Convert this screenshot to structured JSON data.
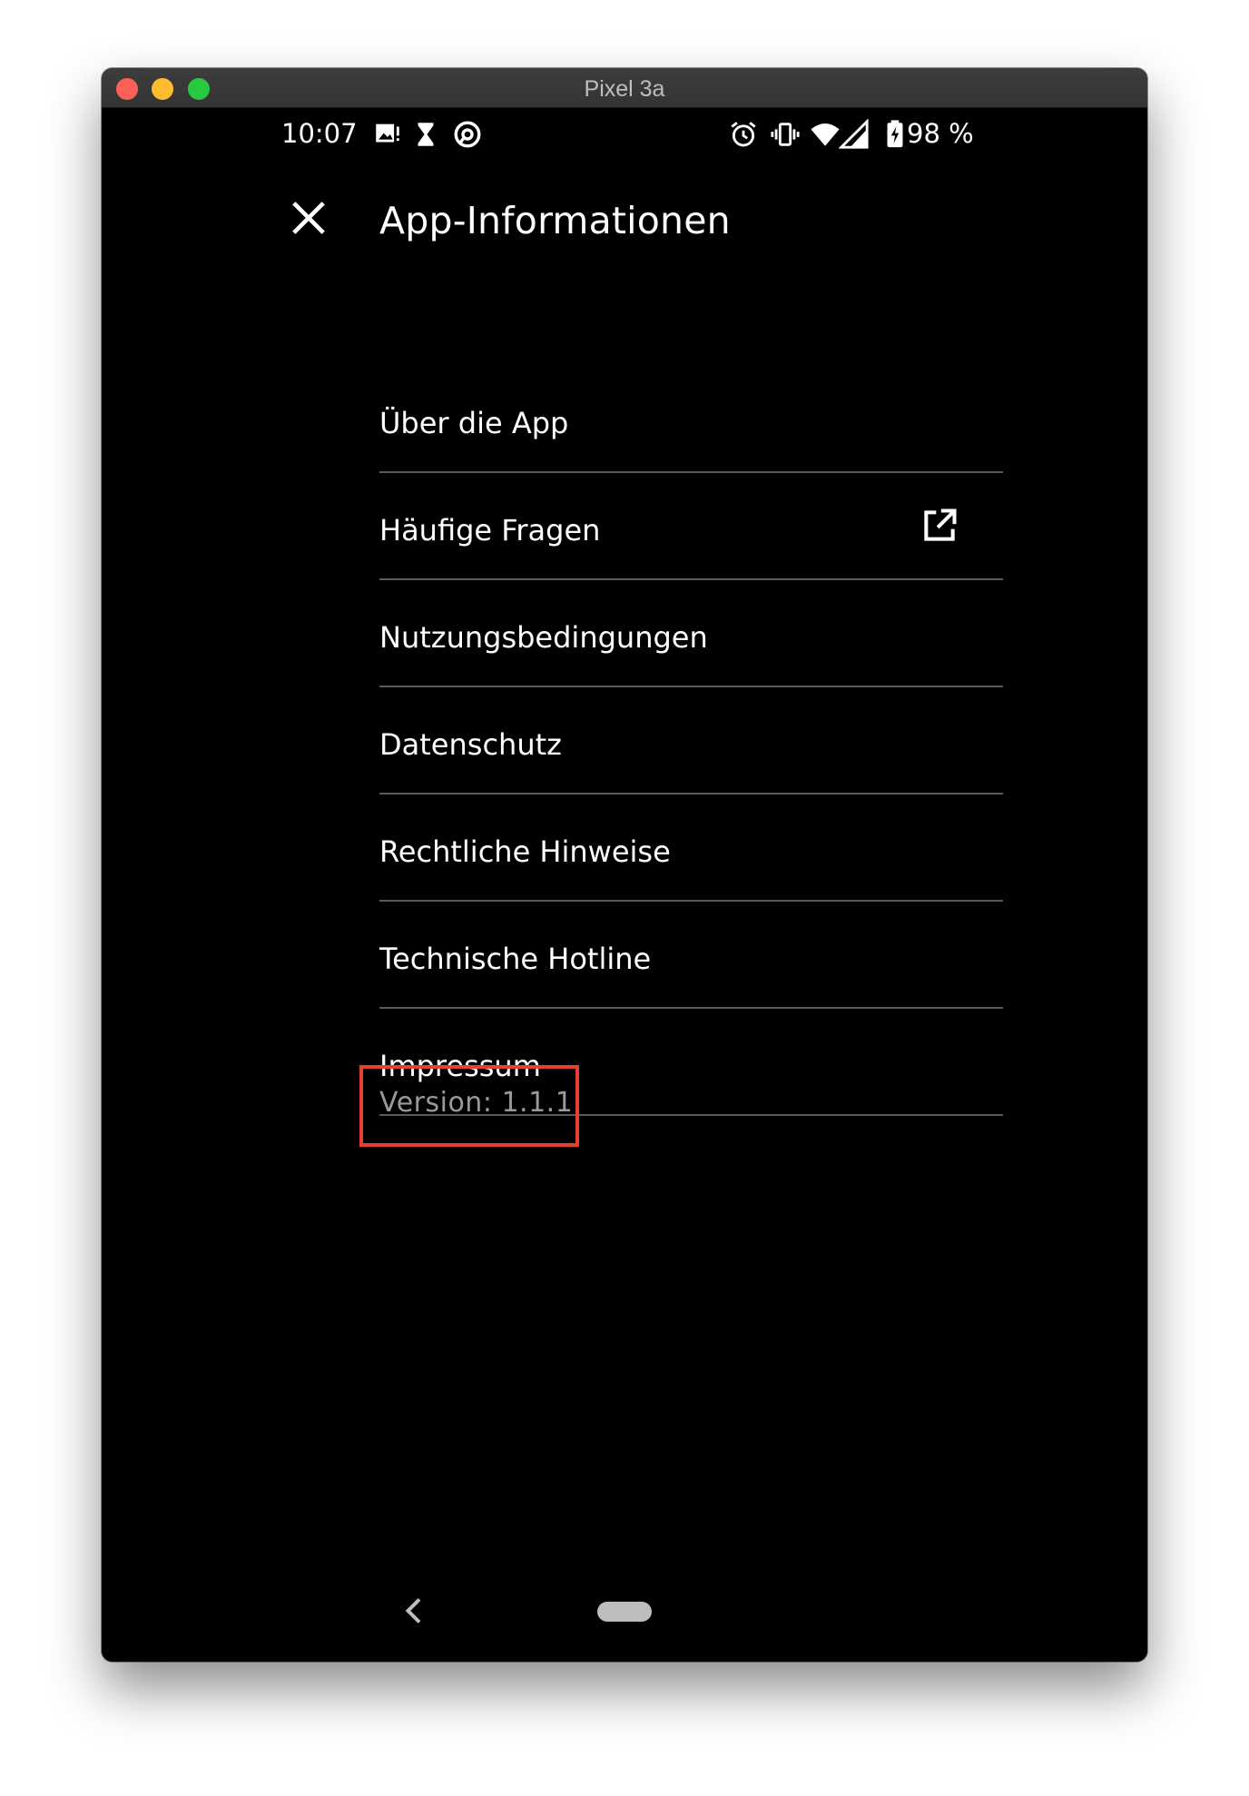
{
  "window": {
    "title": "Pixel 3a"
  },
  "statusbar": {
    "time": "10:07",
    "battery": "98 %",
    "left_icons": [
      "image-notification-icon",
      "hourglass-icon",
      "at-sync-icon"
    ],
    "right_icons": [
      "alarm-icon",
      "vibrate-icon",
      "wifi-icon",
      "signal-icon",
      "battery-charging-icon"
    ]
  },
  "appbar": {
    "title": "App-Informationen",
    "close_icon": "close-icon"
  },
  "menu": {
    "items": [
      {
        "label": "Über die App"
      },
      {
        "label": "Häufige Fragen",
        "icon": "open-external-icon"
      },
      {
        "label": "Nutzungsbedingungen"
      },
      {
        "label": "Datenschutz"
      },
      {
        "label": "Rechtliche Hinweise"
      },
      {
        "label": "Technische Hotline"
      },
      {
        "label": "Impressum"
      }
    ]
  },
  "version": {
    "text": "Version: 1.1.1",
    "highlight_color": "#e5412e"
  },
  "navbar": {
    "back_icon": "back-chevron-icon",
    "home_icon": "home-pill-icon"
  },
  "colors": {
    "background": "#000000",
    "text": "#ffffff",
    "divider": "#5a5a5a",
    "version_text": "#9a9a9a"
  }
}
